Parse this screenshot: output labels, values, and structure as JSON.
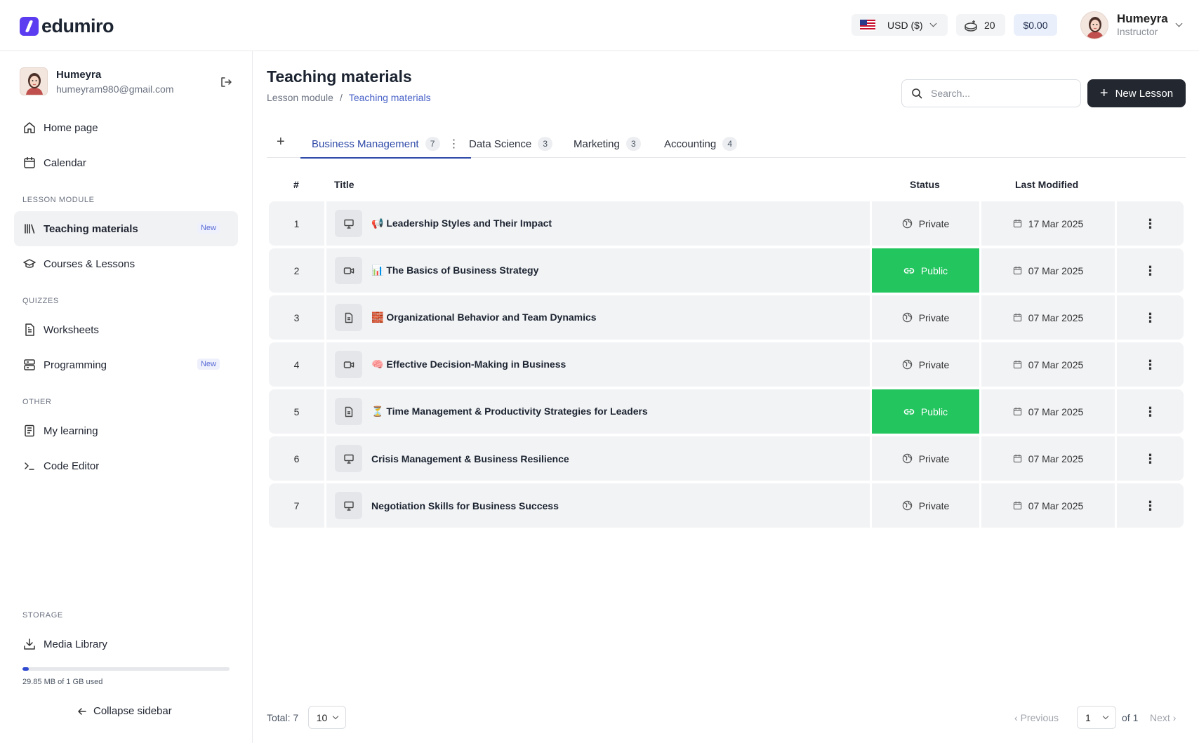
{
  "brand": {
    "name": "edumiro"
  },
  "topbar": {
    "currency": "USD ($)",
    "coins": "20",
    "balance": "$0.00",
    "user_name": "Humeyra",
    "user_role": "Instructor"
  },
  "sidebar": {
    "profile_name": "Humeyra",
    "profile_email": "humeyram980@gmail.com",
    "items": [
      {
        "label": "Home page",
        "icon": "home-icon"
      },
      {
        "label": "Calendar",
        "icon": "calendar-icon"
      },
      {
        "label": "Teaching materials",
        "icon": "library-icon",
        "badge": "New",
        "active": true
      },
      {
        "label": "Courses & Lessons",
        "icon": "graduation-cap-icon"
      },
      {
        "label": "Worksheets",
        "icon": "document-icon"
      },
      {
        "label": "Programming",
        "icon": "server-icon",
        "badge": "New"
      },
      {
        "label": "My learning",
        "icon": "notebook-icon"
      },
      {
        "label": "Code Editor",
        "icon": "terminal-icon"
      },
      {
        "label": "Media Library",
        "icon": "download-icon"
      }
    ],
    "sections": {
      "lesson_module": "LESSON MODULE",
      "quizzes": "QUIZZES",
      "other": "OTHER",
      "storage": "STORAGE"
    },
    "storage_used_fraction": 0.029,
    "storage_text": "29.85 MB of 1 GB used",
    "collapse_label": "Collapse sidebar"
  },
  "page": {
    "title": "Teaching materials",
    "breadcrumb": [
      "Lesson module",
      "/",
      "Teaching materials"
    ],
    "search_placeholder": "Search...",
    "new_lesson_label": "New Lesson"
  },
  "tabs": [
    {
      "label": "Business Management",
      "count": "7",
      "active": true
    },
    {
      "label": "Data Science",
      "count": "3"
    },
    {
      "label": "Marketing",
      "count": "3"
    },
    {
      "label": "Accounting",
      "count": "4"
    }
  ],
  "table": {
    "headers": {
      "num": "#",
      "title": "Title",
      "status": "Status",
      "modified": "Last Modified"
    },
    "rows": [
      {
        "num": "1",
        "type_icon": "presentation-icon",
        "title": "📢 Leadership Styles and Their Impact",
        "status": "Private",
        "date": "17 Mar 2025"
      },
      {
        "num": "2",
        "type_icon": "video-icon",
        "title": "📊 The Basics of Business Strategy",
        "status": "Public",
        "date": "07 Mar 2025"
      },
      {
        "num": "3",
        "type_icon": "document-icon",
        "title": "🧱 Organizational Behavior and Team Dynamics",
        "status": "Private",
        "date": "07 Mar 2025"
      },
      {
        "num": "4",
        "type_icon": "video-icon",
        "title": "🧠 Effective Decision-Making in Business",
        "status": "Private",
        "date": "07 Mar 2025"
      },
      {
        "num": "5",
        "type_icon": "document-icon",
        "title": "⏳ Time Management & Productivity Strategies for Leaders",
        "status": "Public",
        "date": "07 Mar 2025"
      },
      {
        "num": "6",
        "type_icon": "presentation-icon",
        "title": "Crisis Management & Business Resilience",
        "status": "Private",
        "date": "07 Mar 2025"
      },
      {
        "num": "7",
        "type_icon": "presentation-icon",
        "title": "Negotiation Skills for Business Success",
        "status": "Private",
        "date": "07 Mar 2025"
      }
    ]
  },
  "pagination": {
    "total_label": "Total: 7",
    "page_size": "10",
    "prev_label": "Previous",
    "current_page": "1",
    "of_label": "of 1",
    "next_label": "Next"
  },
  "colors": {
    "accent": "#2f4aa8",
    "public": "#22c55e",
    "dark_button": "#232730",
    "brand": "#5b3cf0"
  }
}
